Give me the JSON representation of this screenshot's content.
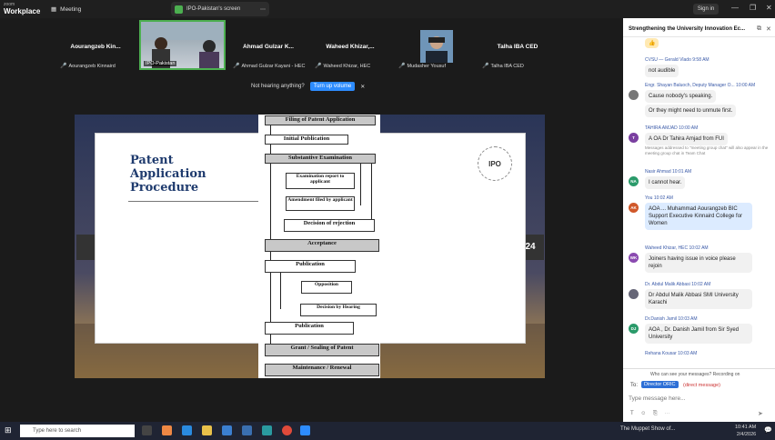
{
  "topbar": {
    "brand_small": "zoom",
    "brand": "Workplace",
    "meeting": "Meeting",
    "tab": "IPO-Pakistan's screen",
    "signin": "Sign in"
  },
  "gallery": [
    {
      "name": "Aourangzeb  Kin...",
      "label": "Aourangzeb Kinnaird"
    },
    {
      "name": "",
      "label": "IPO-Pakistan"
    },
    {
      "name": "Ahmad  Gulzar  K...",
      "label": "Ahmad Gulzar Kayani - HEC"
    },
    {
      "name": "Waheed  Khizar,...",
      "label": "Waheed Khizar, HEC"
    },
    {
      "name": "",
      "label": "Mudasher Yousuf"
    },
    {
      "name": "Talha  IBA  CED",
      "label": "Talha IBA CED"
    }
  ],
  "notice": {
    "text": "Not hearing anything?",
    "button": "Turn up volume",
    "close": "✕"
  },
  "slide": {
    "title1": "Patent",
    "title2": "Application",
    "title3": "Procedure",
    "logo": "IPO",
    "page": "24",
    "steps": [
      "Filing of Patent Application",
      "Initial Publication",
      "Substantive Examination",
      "Examination report to applicant",
      "Amendment filed by applicant",
      "Decision of rejection",
      "Acceptance",
      "Publication",
      "Opposition",
      "Decision by Hearing",
      "Publication",
      "Grant / Sealing of Patent",
      "Maintenance / Renewal"
    ]
  },
  "chat": {
    "title": "Strengthening the University Innovation Ec...",
    "messages": [
      {
        "from": "CVSU — Gerald Vlado  9:58 AM",
        "text": "not audible"
      },
      {
        "from": "Engr. Shayan Baluoch, Deputy Manager O...  10:00 AM",
        "text": "Cause nobody's speaking."
      },
      {
        "from": "",
        "text": "Or they might need to unmute first."
      },
      {
        "from": "TAHIRA AMJAD  10:00 AM",
        "text": "A OA Dr Tahira Amjad from FUI"
      },
      {
        "from": "Nasir Ahmad  10:01 AM",
        "text": "I cannot hear."
      },
      {
        "from": "You  10:02 AM",
        "text": "AOA ... Muhammad Aourangzeb BIC Support Executive Kinnaird College for Women"
      },
      {
        "from": "Waheed Khizar, HEC  10:02 AM",
        "text": "Joiners having issue in voice please rejoin"
      },
      {
        "from": "Dr. Abdul Malik Abbasi  10:02 AM",
        "text": "Dr Abdul Malik Abbasi SMI University Karachi"
      },
      {
        "from": "Dr.Danish Jamil  10:03 AM",
        "text": "AOA , Dr. Danish Jamil from Sir Syed University"
      },
      {
        "from": "Rehana Kousar  10:03 AM",
        "text": ""
      }
    ],
    "note": "Messages addressed to \"meeting group chat\" will also appear in the meeting group chat in Team Chat",
    "who": "Who can see your messages? Recording on",
    "to": "To:",
    "recipient": "Director ORIC",
    "direct": "(direct message)",
    "placeholder": "Type message here..."
  },
  "taskbar": {
    "search": "Type here to search",
    "app": "The Muppet Show of...",
    "time": "10:41 AM",
    "date": "2/4/2026"
  }
}
